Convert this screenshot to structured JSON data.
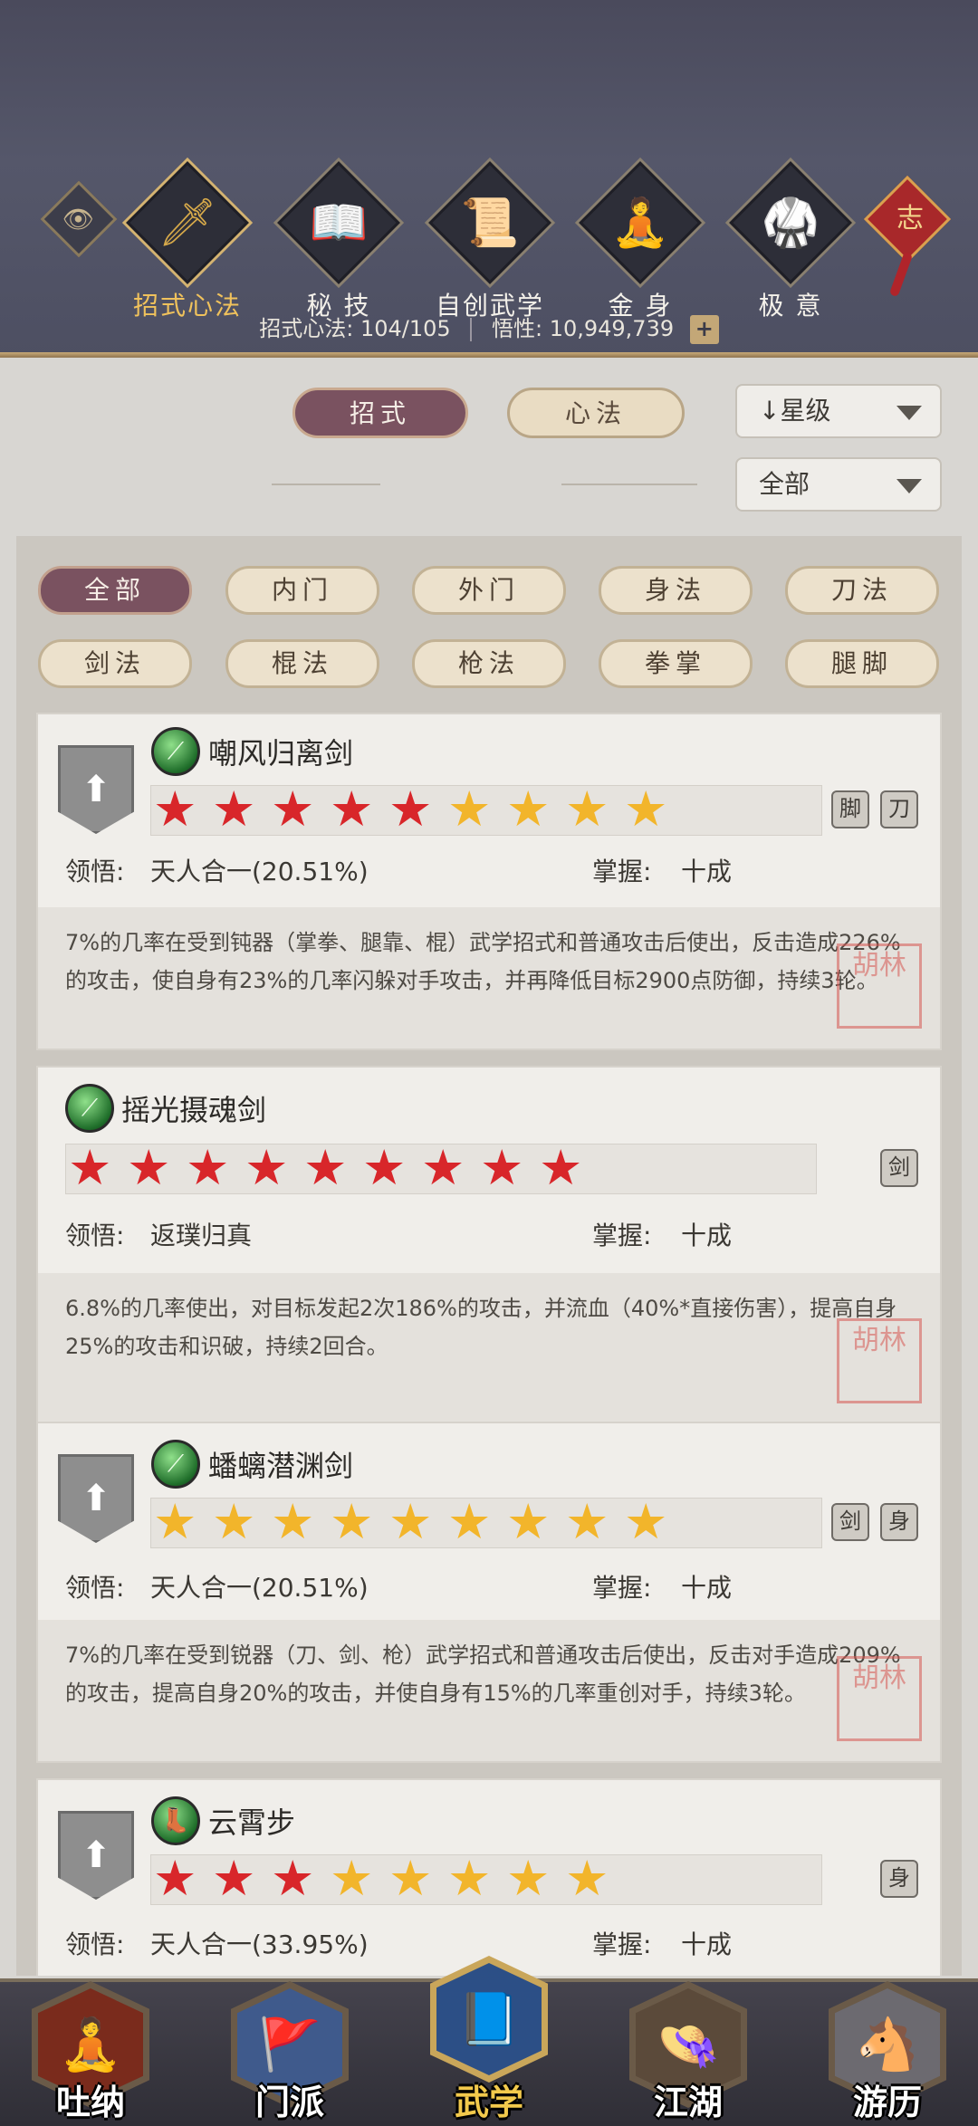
{
  "header": {
    "nav": [
      {
        "label": "招式心法",
        "icon": "sword-icon",
        "glyph": "🗡",
        "active": true
      },
      {
        "label": "秘 技",
        "icon": "book-icon",
        "glyph": "📖",
        "active": false
      },
      {
        "label": "自创武学",
        "icon": "scroll-icon",
        "glyph": "📜",
        "active": false
      },
      {
        "label": "金 身",
        "icon": "meditate-icon",
        "glyph": "🧘",
        "active": false
      },
      {
        "label": "极 意",
        "icon": "kungfu-icon",
        "glyph": "🥋",
        "active": false
      }
    ],
    "knot_char": "志",
    "stat1_label": "招式心法:",
    "stat1_value": "104/105",
    "stat2_label": "悟性:",
    "stat2_value": "10,949,739",
    "plus_label": "+"
  },
  "tabs": {
    "zhaoshi": "招式",
    "xinfa": "心法"
  },
  "filters": {
    "sort": "↓星级",
    "scope": "全部"
  },
  "categories": [
    "全部",
    "内门",
    "外门",
    "身法",
    "刀法",
    "剑法",
    "棍法",
    "枪法",
    "拳掌",
    "腿脚"
  ],
  "active_category": "全部",
  "labels": {
    "lingwu": "领悟:",
    "zhangwo": "掌握:",
    "seal": "胡林"
  },
  "skills": [
    {
      "name": "嘲风归离剑",
      "stars_red": 5,
      "stars_gold": 4,
      "lingwu": "天人合一(20.51%)",
      "zhangwo": "十成",
      "desc": "7%的几率在受到钝器（掌拳、腿靠、棍）武学招式和普通攻击后使出，反击造成226%的攻击，使自身有23%的几率闪躲对手攻击，并再降低目标2900点防御，持续3轮。",
      "has_shield": true,
      "minis": [
        "脚",
        "刀"
      ]
    },
    {
      "name": "摇光摄魂剑",
      "stars_red": 9,
      "stars_gold": 0,
      "lingwu": "返璞归真",
      "zhangwo": "十成",
      "desc": "6.8%的几率使出，对目标发起2次186%的攻击，并流血（40%*直接伤害），提高自身25%的攻击和识破，持续2回合。",
      "has_shield": false,
      "minis": [
        "剑"
      ]
    },
    {
      "name": "蟠螭潜渊剑",
      "stars_red": 0,
      "stars_gold": 9,
      "lingwu": "天人合一(20.51%)",
      "zhangwo": "十成",
      "desc": "7%的几率在受到锐器（刀、剑、枪）武学招式和普通攻击后使出，反击对手造成209%的攻击，提高自身20%的攻击，并使自身有15%的几率重创对手，持续3轮。",
      "has_shield": true,
      "minis": [
        "剑",
        "身"
      ]
    },
    {
      "name": "云霄步",
      "stars_red": 3,
      "stars_gold": 5,
      "lingwu": "天人合一(33.95%)",
      "zhangwo": "十成",
      "desc": "",
      "has_shield": true,
      "minis": [
        "身"
      ]
    }
  ],
  "bottom_nav": [
    {
      "label": "吐纳",
      "icon": "monk-icon",
      "glyph": "🧘",
      "color": "#7a2b1c"
    },
    {
      "label": "门派",
      "icon": "banner-icon",
      "glyph": "🚩",
      "color": "#3f5a8c"
    },
    {
      "label": "武学",
      "icon": "manual-icon",
      "glyph": "📘",
      "color": "#2c4f86",
      "active": true
    },
    {
      "label": "江湖",
      "icon": "hat-icon",
      "glyph": "👒",
      "color": "#5b4a3a"
    },
    {
      "label": "游历",
      "icon": "horse-icon",
      "glyph": "🐴",
      "color": "#6c6a70"
    }
  ]
}
